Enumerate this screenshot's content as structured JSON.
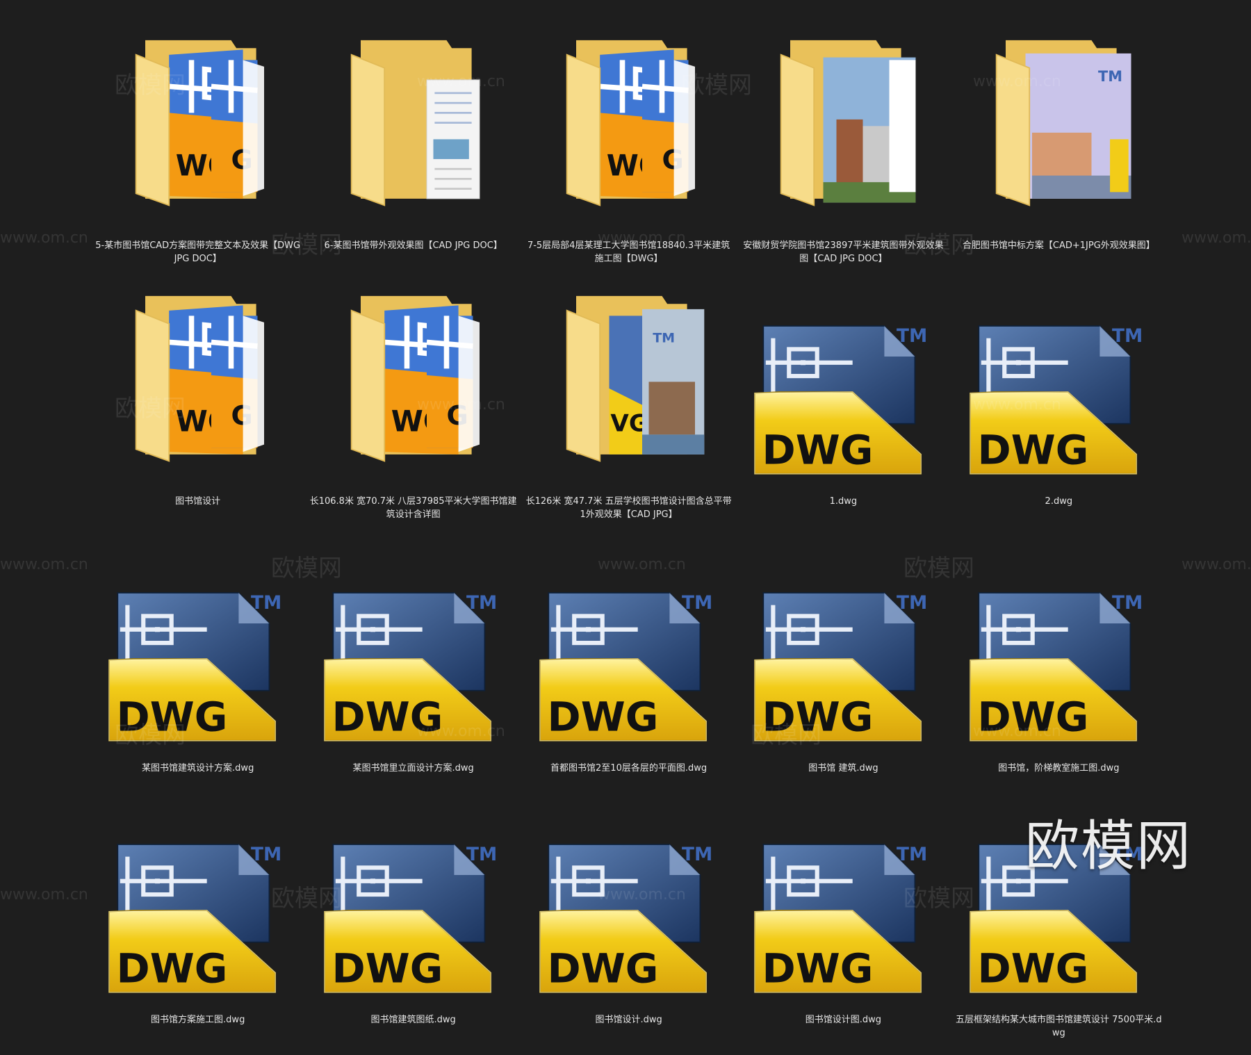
{
  "window": {
    "background": "#1e1e1e"
  },
  "icon_names": {
    "folder": "folder-icon",
    "dwg": "dwg-file-icon"
  },
  "items": [
    {
      "type": "folder",
      "variant": "dwg",
      "label": "5-某市图书馆CAD方案图带完整文本及效果【DWG  JPG DOC】"
    },
    {
      "type": "folder",
      "variant": "doc",
      "label": "6-某图书馆带外观效果图【CAD JPG DOC】"
    },
    {
      "type": "folder",
      "variant": "dwg",
      "label": "7-5层局部4层某理工大学图书馆18840.3平米建筑施工图【DWG】"
    },
    {
      "type": "folder",
      "variant": "photo",
      "label": "安徽财贸学院图书馆23897平米建筑图带外观效果图【CAD JPG DOC】"
    },
    {
      "type": "folder",
      "variant": "photo2",
      "label": "合肥图书馆中标方案【CAD+1JPG外观效果图】"
    },
    {
      "type": "folder",
      "variant": "dwg",
      "label": "图书馆设计"
    },
    {
      "type": "folder",
      "variant": "dwg",
      "label": "长106.8米 宽70.7米 八层37985平米大学图书馆建筑设计含详图"
    },
    {
      "type": "folder",
      "variant": "photo3",
      "label": "长126米 宽47.7米 五层学校图书馆设计图含总平带1外观效果【CAD JPG】"
    },
    {
      "type": "file",
      "label": "1.dwg"
    },
    {
      "type": "file",
      "label": "2.dwg"
    },
    {
      "type": "file",
      "label": "某图书馆建筑设计方案.dwg"
    },
    {
      "type": "file",
      "label": "某图书馆里立面设计方案.dwg"
    },
    {
      "type": "file",
      "label": "首都图书馆2至10层各层的平面图.dwg"
    },
    {
      "type": "file",
      "label": "图书馆 建筑.dwg"
    },
    {
      "type": "file",
      "label": "图书馆，阶梯教室施工图.dwg"
    },
    {
      "type": "file",
      "label": "图书馆方案施工图.dwg"
    },
    {
      "type": "file",
      "label": "图书馆建筑图纸.dwg"
    },
    {
      "type": "file",
      "label": "图书馆设计.dwg"
    },
    {
      "type": "file",
      "label": "图书馆设计图.dwg"
    },
    {
      "type": "file",
      "label": "五层框架结构某大城市图书馆建筑设计 7500平米.dwg"
    }
  ],
  "dwg_icon": {
    "tm": "TM",
    "text": "DWG",
    "colors": {
      "blue_dark": "#1c3560",
      "blue_light": "#5d80b4",
      "yellow": "#f2cc18",
      "tm": "#3d66b3"
    }
  },
  "folder_colors": {
    "front": "#f7dc8a",
    "back": "#e9c15a",
    "drawing_blue": "#3f77d4",
    "orange": "#f49a12"
  },
  "watermark": {
    "cn": "欧模网",
    "url": "www.om.cn"
  },
  "brand": {
    "text": "欧模网"
  }
}
